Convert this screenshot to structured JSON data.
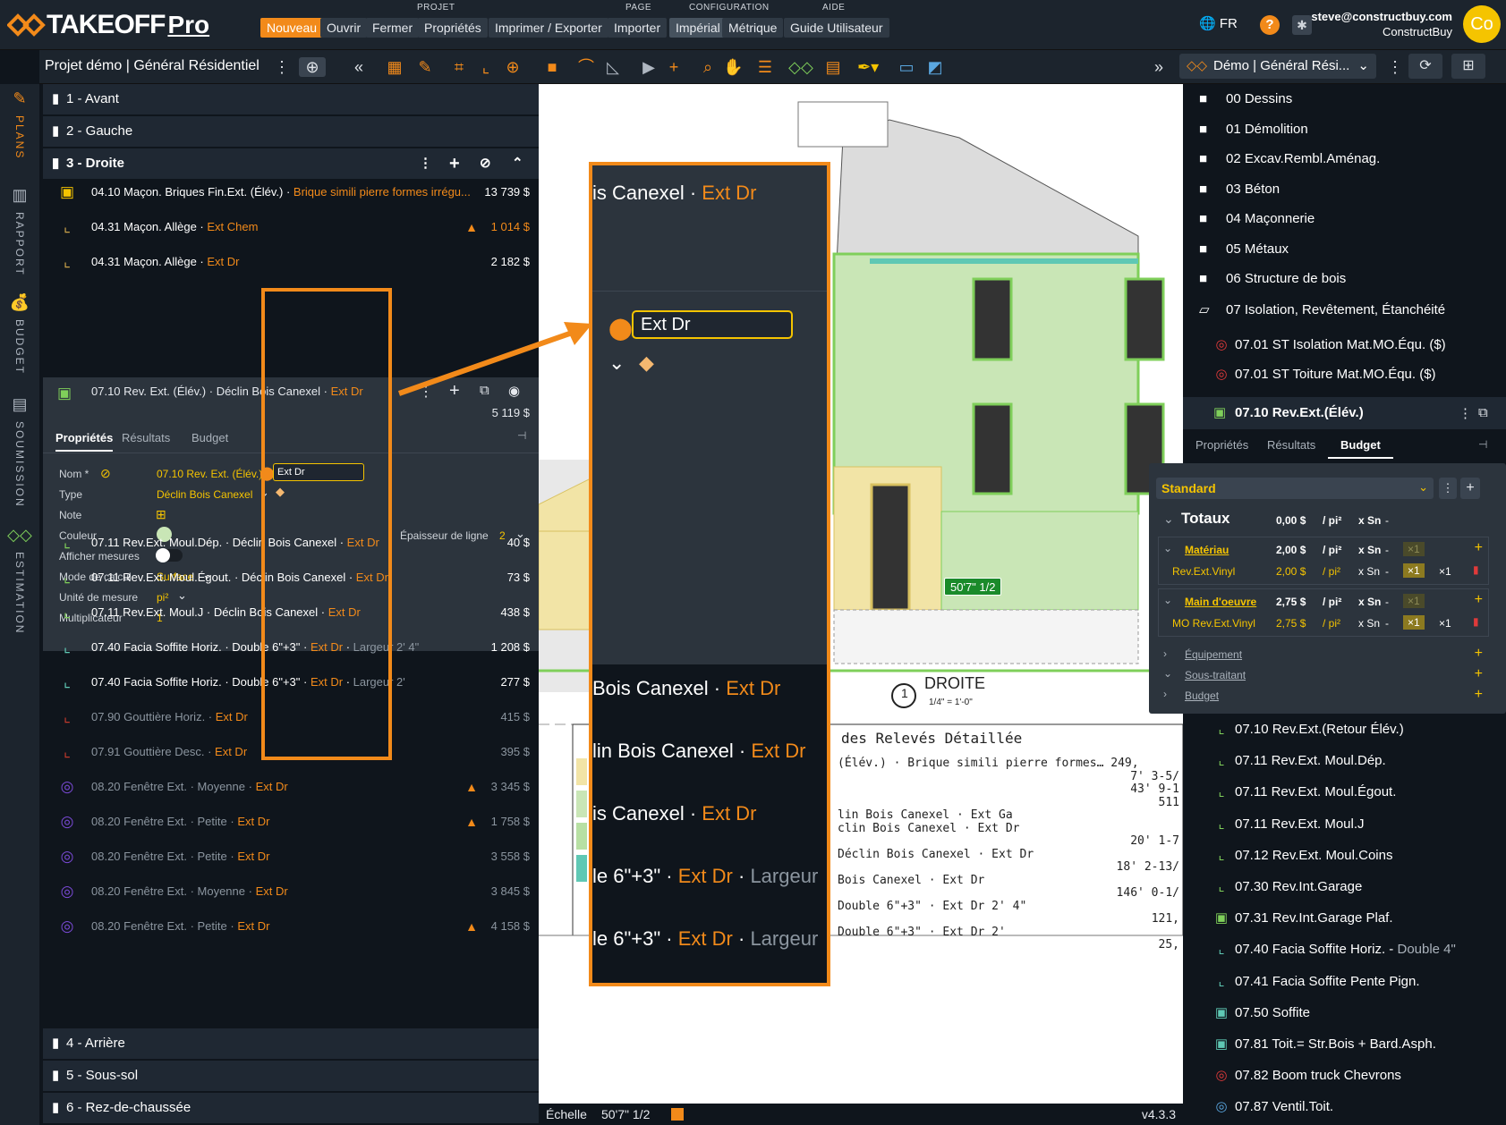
{
  "header": {
    "logo_text": "TAKEOFF",
    "logo_pro": "Pro",
    "groups": {
      "projet": "PROJET",
      "page": "PAGE",
      "configuration": "CONFIGURATION",
      "aide": "AIDE"
    },
    "buttons": {
      "nouveau": "Nouveau",
      "ouvrir": "Ouvrir",
      "fermer": "Fermer",
      "proprietes": "Propriétés",
      "imprimer": "Imprimer / Exporter",
      "importer": "Importer",
      "imperial": "Impérial",
      "metrique": "Métrique",
      "guide": "Guide Utilisateur"
    },
    "lang": "FR",
    "user_email": "steve@constructbuy.com",
    "user_company": "ConstructBuy",
    "avatar": "Co"
  },
  "toolbar": {
    "project_title": "Projet démo | Général Résidentiel",
    "project_select": "Démo | Général Rési..."
  },
  "vnav": [
    {
      "label": "PLANS",
      "icon": "ruler-icon"
    },
    {
      "label": "RAPPORT",
      "icon": "chart-icon"
    },
    {
      "label": "BUDGET",
      "icon": "money-bag-icon"
    },
    {
      "label": "SOUMISSION",
      "icon": "document-icon"
    },
    {
      "label": "ESTIMATION",
      "icon": "logo-icon"
    }
  ],
  "pages_top": [
    "1 - Avant",
    "2 - Gauche",
    "3 - Droite"
  ],
  "pages_bottom": [
    "4 - Arrière",
    "5 - Sous-sol",
    "6 - Rez-de-chaussée"
  ],
  "items_top": [
    {
      "code": "04.10 Maçon. Briques Fin.Ext. (Élév.)",
      "desc": "Brique simili pierre formes irrégu...",
      "loc": "",
      "value": "13 739 $",
      "warn": false,
      "color": "#f5c400"
    },
    {
      "code": "04.31 Maçon. Allège",
      "desc": "",
      "loc": "Ext Chem",
      "value": "1 014 $",
      "warn": true,
      "color": "#c9a14a"
    },
    {
      "code": "04.31 Maçon. Allège",
      "desc": "",
      "loc": "Ext Dr",
      "value": "2 182 $",
      "warn": false,
      "color": "#c9a14a"
    }
  ],
  "selected_item": {
    "code": "07.10 Rev. Ext. (Élév.)",
    "desc": "Déclin Bois Canexel",
    "loc": "Ext Dr",
    "value": "5 119 $"
  },
  "props": {
    "tabs": [
      "Propriétés",
      "Résultats",
      "Budget"
    ],
    "labels": {
      "nom": "Nom *",
      "type": "Type",
      "note": "Note",
      "couleur": "Couleur",
      "afficher": "Afficher mesures",
      "mode": "Mode de calcul",
      "unite": "Unité de mesure",
      "mult": "Multiplicateur",
      "epaisseur": "Épaisseur de ligne"
    },
    "values": {
      "nom": "07.10 Rev. Ext. (Élév.)",
      "location": "Ext Dr",
      "type": "Déclin Bois Canexel",
      "mode": "Surface",
      "unite": "pi²",
      "mult": "1",
      "epaisseur": "2"
    }
  },
  "items_bottom": [
    {
      "code": "07.11 Rev.Ext. Moul.Dép.",
      "desc": "Déclin Bois Canexel",
      "loc": "Ext Dr",
      "extra": "",
      "value": "40 $",
      "warn": false,
      "dim": false,
      "color": "#7fcf5a"
    },
    {
      "code": "07.11 Rev.Ext. Moul.Égout.",
      "desc": "Déclin Bois Canexel",
      "loc": "Ext Dr",
      "extra": "",
      "value": "73 $",
      "warn": false,
      "dim": false,
      "color": "#7fcf5a"
    },
    {
      "code": "07.11 Rev.Ext. Moul.J",
      "desc": "Déclin Bois Canexel",
      "loc": "Ext Dr",
      "extra": "",
      "value": "438 $",
      "warn": false,
      "dim": false,
      "color": "#7fcf5a"
    },
    {
      "code": "07.40 Facia Soffite Horiz.",
      "desc": "Double 6\"+3\"",
      "loc": "Ext Dr",
      "extra": "Largeur 2' 4\"",
      "value": "1 208 $",
      "warn": false,
      "dim": false,
      "color": "#5fc8b4"
    },
    {
      "code": "07.40 Facia Soffite Horiz.",
      "desc": "Double 6\"+3\"",
      "loc": "Ext Dr",
      "extra": "Largeur 2'",
      "value": "277 $",
      "warn": false,
      "dim": false,
      "color": "#5fc8b4"
    },
    {
      "code": "07.90 Gouttière Horiz.",
      "desc": "",
      "loc": "Ext Dr",
      "extra": "",
      "value": "415 $",
      "warn": false,
      "dim": true,
      "color": "#c0392b"
    },
    {
      "code": "07.91 Gouttière Desc.",
      "desc": "",
      "loc": "Ext Dr",
      "extra": "",
      "value": "395 $",
      "warn": false,
      "dim": true,
      "color": "#c0392b"
    },
    {
      "code": "08.20 Fenêtre Ext.",
      "desc": "Moyenne",
      "loc": "Ext Dr",
      "extra": "",
      "value": "3 345 $",
      "warn": true,
      "dim": true,
      "color": "#7b4ad8"
    },
    {
      "code": "08.20 Fenêtre Ext.",
      "desc": "Petite",
      "loc": "Ext Dr",
      "extra": "",
      "value": "1 758 $",
      "warn": true,
      "dim": true,
      "color": "#7b4ad8"
    },
    {
      "code": "08.20 Fenêtre Ext.",
      "desc": "Petite",
      "loc": "Ext Dr",
      "extra": "",
      "value": "3 558 $",
      "warn": false,
      "dim": true,
      "color": "#7b4ad8"
    },
    {
      "code": "08.20 Fenêtre Ext.",
      "desc": "Moyenne",
      "loc": "Ext Dr",
      "extra": "",
      "value": "3 845 $",
      "warn": false,
      "dim": true,
      "color": "#7b4ad8"
    },
    {
      "code": "08.20 Fenêtre Ext.",
      "desc": "Petite",
      "loc": "Ext Dr",
      "extra": "",
      "value": "4 158 $",
      "warn": true,
      "dim": true,
      "color": "#7b4ad8"
    }
  ],
  "zoom": {
    "top_text": "is Canexel",
    "top_loc": "Ext Dr",
    "input": "Ext Dr",
    "rows": [
      {
        "a": "Bois Canexel",
        "b": "Ext Dr",
        "c": ""
      },
      {
        "a": "lin Bois Canexel",
        "b": "Ext Dr",
        "c": ""
      },
      {
        "a": "is Canexel",
        "b": "Ext Dr",
        "c": ""
      },
      {
        "a": "le 6\"+3\"",
        "b": "Ext Dr",
        "c": "Largeur"
      },
      {
        "a": "le 6\"+3\"",
        "b": "Ext Dr",
        "c": "Largeur"
      }
    ]
  },
  "drawing": {
    "dimension": "50'7\" 1/2",
    "view_num": "1",
    "view_title": "DROITE",
    "view_scale": "1/4\" = 1'-0\"",
    "table_title": "des Relevés Détaillée",
    "table_lines": [
      "(Élév.) · Brique simili pierre formes… 249,",
      "7' 3-5/",
      "43' 9-1",
      "511",
      "lin Bois Canexel · Ext Ga",
      "clin Bois Canexel · Ext Dr",
      "20' 1-7",
      "Déclin Bois Canexel · Ext Dr",
      "18' 2-13/",
      "Bois Canexel · Ext Dr",
      "146' 0-1/",
      "Double 6\"+3\" · Ext Dr 2' 4\"",
      "121,",
      "Double 6\"+3\" · Ext Dr 2'",
      "25,"
    ]
  },
  "status": {
    "echelle": "Échelle",
    "scale": "50'7\" 1/2",
    "version": "v4.3.3"
  },
  "folders": [
    "00 Dessins",
    "01 Démolition",
    "02 Excav.Rembl.Aménag.",
    "03 Béton",
    "04 Maçonnerie",
    "05 Métaux",
    "06 Structure de bois",
    "07 Isolation, Revêtement, Étanchéité"
  ],
  "rentries_top": [
    {
      "label": "07.01 ST Isolation Mat.MO.Équ. ($)",
      "color": "#e03a3a",
      "icon": "◎"
    },
    {
      "label": "07.01 ST Toiture Mat.MO.Équ. ($)",
      "color": "#e03a3a",
      "icon": "◎"
    }
  ],
  "rselected": {
    "label": "07.10 Rev.Ext.(Élév.)",
    "tabs": [
      "Propriétés",
      "Résultats",
      "Budget"
    ]
  },
  "budget": {
    "preset": "Standard",
    "totaux": {
      "label": "Totaux",
      "amount": "0,00 $",
      "unit": "/ pi²",
      "xsn": "x Sn",
      "dash": "-"
    },
    "materiau": {
      "label": "Matériau",
      "amount": "2,00 $",
      "unit": "/ pi²",
      "xsn": "x Sn",
      "dash": "-",
      "mult": "×1",
      "sub": {
        "label": "Rev.Ext.Vinyl",
        "amount": "2,00 $",
        "unit": "/ pi²",
        "xsn": "x Sn",
        "dash": "-",
        "mult": "×1",
        "mult2": "×1"
      }
    },
    "main": {
      "label": "Main d'oeuvre",
      "amount": "2,75 $",
      "unit": "/ pi²",
      "xsn": "x Sn",
      "dash": "-",
      "mult": "×1",
      "sub": {
        "label": "MO Rev.Ext.Vinyl",
        "amount": "2,75 $",
        "unit": "/ pi²",
        "xsn": "x Sn",
        "dash": "-",
        "mult": "×1",
        "mult2": "×1"
      }
    },
    "equipement": "Équipement",
    "soustraitant": "Sous-traitant",
    "budget": "Budget"
  },
  "rentries_bottom": [
    {
      "label": "07.10 Rev.Ext.(Retour Élév.)",
      "extra": "",
      "color": "#7fcf5a",
      "icon": "⌞"
    },
    {
      "label": "07.11 Rev.Ext. Moul.Dép.",
      "extra": "",
      "color": "#7fcf5a",
      "icon": "⌞"
    },
    {
      "label": "07.11 Rev.Ext. Moul.Égout.",
      "extra": "",
      "color": "#7fcf5a",
      "icon": "⌞"
    },
    {
      "label": "07.11 Rev.Ext. Moul.J",
      "extra": "",
      "color": "#7fcf5a",
      "icon": "⌞"
    },
    {
      "label": "07.12 Rev.Ext. Moul.Coins",
      "extra": "",
      "color": "#7fcf5a",
      "icon": "⌞"
    },
    {
      "label": "07.30 Rev.Int.Garage",
      "extra": "",
      "color": "#7fcf5a",
      "icon": "⌞"
    },
    {
      "label": "07.31 Rev.Int.Garage Plaf.",
      "extra": "",
      "color": "#7fcf5a",
      "icon": "▣"
    },
    {
      "label": "07.40 Facia Soffite Horiz. -",
      "extra": "Double 4\"",
      "color": "#5fc8b4",
      "icon": "⌞"
    },
    {
      "label": "07.41 Facia Soffite Pente Pign.",
      "extra": "",
      "color": "#5fc8b4",
      "icon": "⌞"
    },
    {
      "label": "07.50 Soffite",
      "extra": "",
      "color": "#5fc8b4",
      "icon": "▣"
    },
    {
      "label": "07.81 Toit.= Str.Bois + Bard.Asph.",
      "extra": "",
      "color": "#5fc8b4",
      "icon": "▣"
    },
    {
      "label": "07.82 Boom truck Chevrons",
      "extra": "",
      "color": "#e03a3a",
      "icon": "◎"
    },
    {
      "label": "07.87 Ventil.Toit.",
      "extra": "",
      "color": "#5aa7e0",
      "icon": "◎"
    }
  ]
}
